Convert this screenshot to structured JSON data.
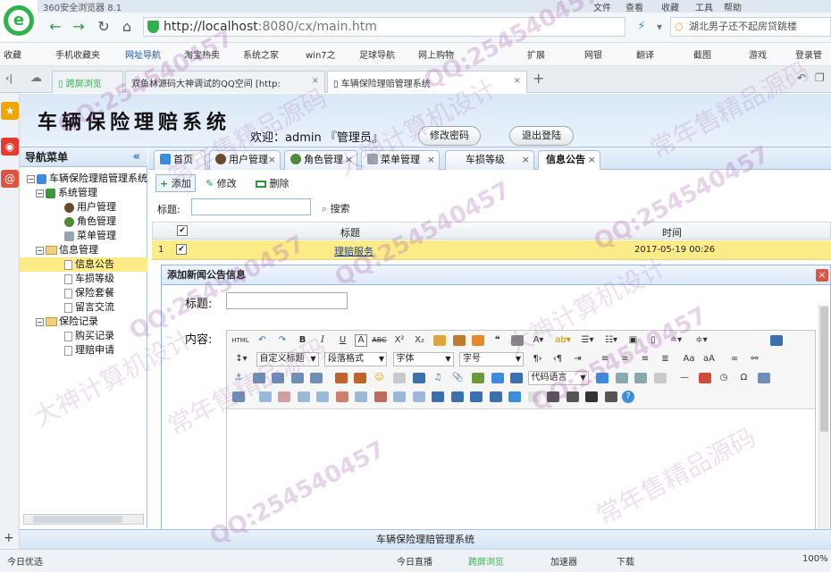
{
  "browser": {
    "app_name": "360安全浏览器 8.1",
    "menu": [
      "文件",
      "查看",
      "收藏",
      "工具",
      "帮助"
    ],
    "url_host": "http://localhost",
    "url_path": ":8080/cx/main.htm",
    "search_text": "湖北男子还不起房贷跳楼",
    "bookmarks": [
      "收藏",
      "手机收藏夹",
      "网址导航",
      "淘宝热卖",
      "系统之家",
      "win7之",
      "足球导航",
      "网上购物",
      "扩展",
      "网银",
      "翻译",
      "截图",
      "游戏",
      "登录管"
    ],
    "tabs": [
      {
        "label": "跨屏浏览"
      },
      {
        "label": "双鱼林源码大神调试的QQ空间 [http:"
      },
      {
        "label": "车辆保险理赔管理系统"
      }
    ],
    "status": {
      "left": "今日优选",
      "live": "今日直播",
      "cross": "跨屏浏览",
      "speed": "加速器",
      "download": "下载",
      "zoom": "100%"
    }
  },
  "app": {
    "title": "车辆保险理赔系统",
    "welcome": "欢迎：admin 『管理员』",
    "change_pwd": "修改密码",
    "logout": "退出登陆",
    "footer": "车辆保险理赔管理系统"
  },
  "nav": {
    "header": "导航菜单",
    "collapse": "«",
    "root": "车辆保险理赔管理系统",
    "groups": [
      {
        "label": "系统管理",
        "items": [
          "用户管理",
          "角色管理",
          "菜单管理"
        ]
      },
      {
        "label": "信息管理",
        "items": [
          "信息公告",
          "车损等级",
          "保险套餐",
          "留言交流"
        ]
      },
      {
        "label": "保险记录",
        "items": [
          "购买记录",
          "理赔申请"
        ]
      }
    ]
  },
  "content_tabs": [
    "首页",
    "用户管理",
    "角色管理",
    "菜单管理",
    "车损等级",
    "信息公告"
  ],
  "toolbar": {
    "add": "添加",
    "edit": "修改",
    "delete": "删除"
  },
  "search": {
    "label": "标题:",
    "button": "搜索"
  },
  "grid": {
    "columns": [
      "标题",
      "时间"
    ],
    "rows": [
      {
        "num": "1",
        "title": "理赔服务",
        "time": "2017-05-19 00:26"
      }
    ]
  },
  "dialog": {
    "title": "添加新闻公告信息",
    "title_label": "标题:",
    "content_label": "内容:",
    "editor": {
      "html": "HTML",
      "custom_title": "自定义标题",
      "paragraph": "段落格式",
      "font": "字体",
      "size": "字号",
      "code": "代码语言"
    }
  },
  "watermark": {
    "qq": "QQ:254540457",
    "a": "常年售精品源码",
    "b": "大神计算机设计"
  },
  "colors": {
    "accent": "#2eb34a",
    "selected": "#fbec88",
    "panel_border": "#a8c2de"
  }
}
